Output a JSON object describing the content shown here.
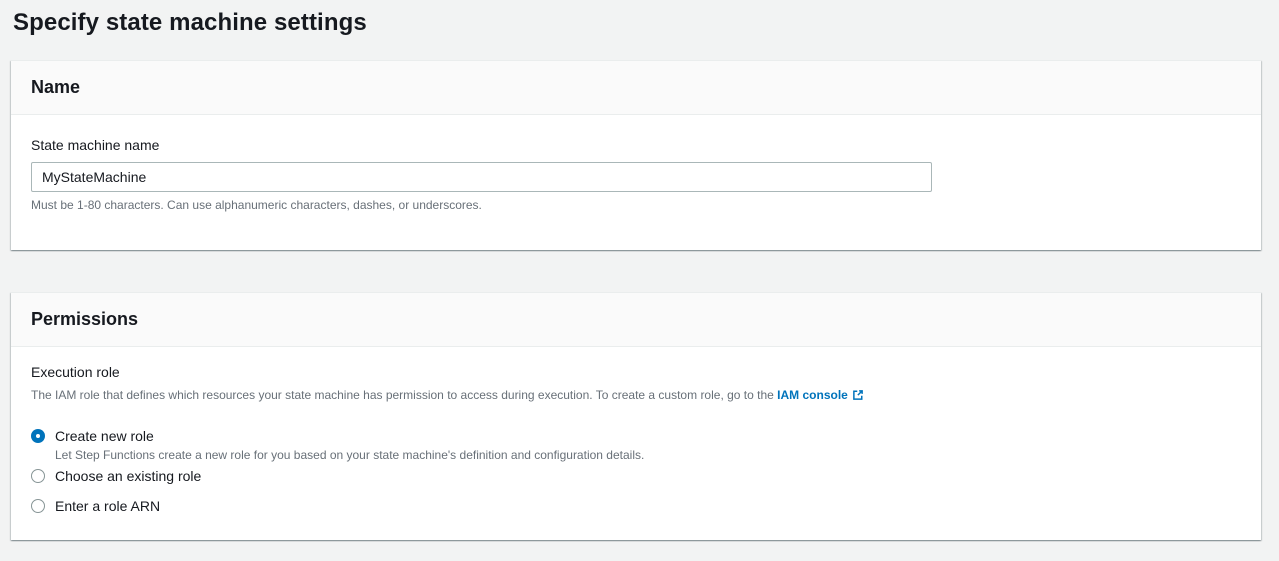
{
  "page": {
    "title": "Specify state machine settings"
  },
  "colors": {
    "page_bg": "#f2f3f3",
    "card_header_bg": "#fafafa",
    "divider": "#eaeded",
    "heading_text": "#16191f",
    "secondary_text": "#687078",
    "input_border": "#aab7b8",
    "accent_blue": "#0073bb",
    "radio_selected": "#0073bb"
  },
  "icons": {
    "external-link-icon": "↗"
  },
  "name_section": {
    "title": "Name",
    "field_label": "State machine name",
    "field_value": "MyStateMachine",
    "field_hint": "Must be 1-80 characters. Can use alphanumeric characters, dashes, or underscores."
  },
  "permissions_section": {
    "title": "Permissions",
    "field_label": "Execution role",
    "description_prefix": "The IAM role that defines which resources your state machine has permission to access during execution. To create a custom role, go to the ",
    "link_label": "IAM console",
    "options": [
      {
        "label": "Create new role",
        "description": "Let Step Functions create a new role for you based on your state machine's definition and configuration details.",
        "selected": true
      },
      {
        "label": "Choose an existing role",
        "description": "",
        "selected": false
      },
      {
        "label": "Enter a role ARN",
        "description": "",
        "selected": false
      }
    ]
  }
}
